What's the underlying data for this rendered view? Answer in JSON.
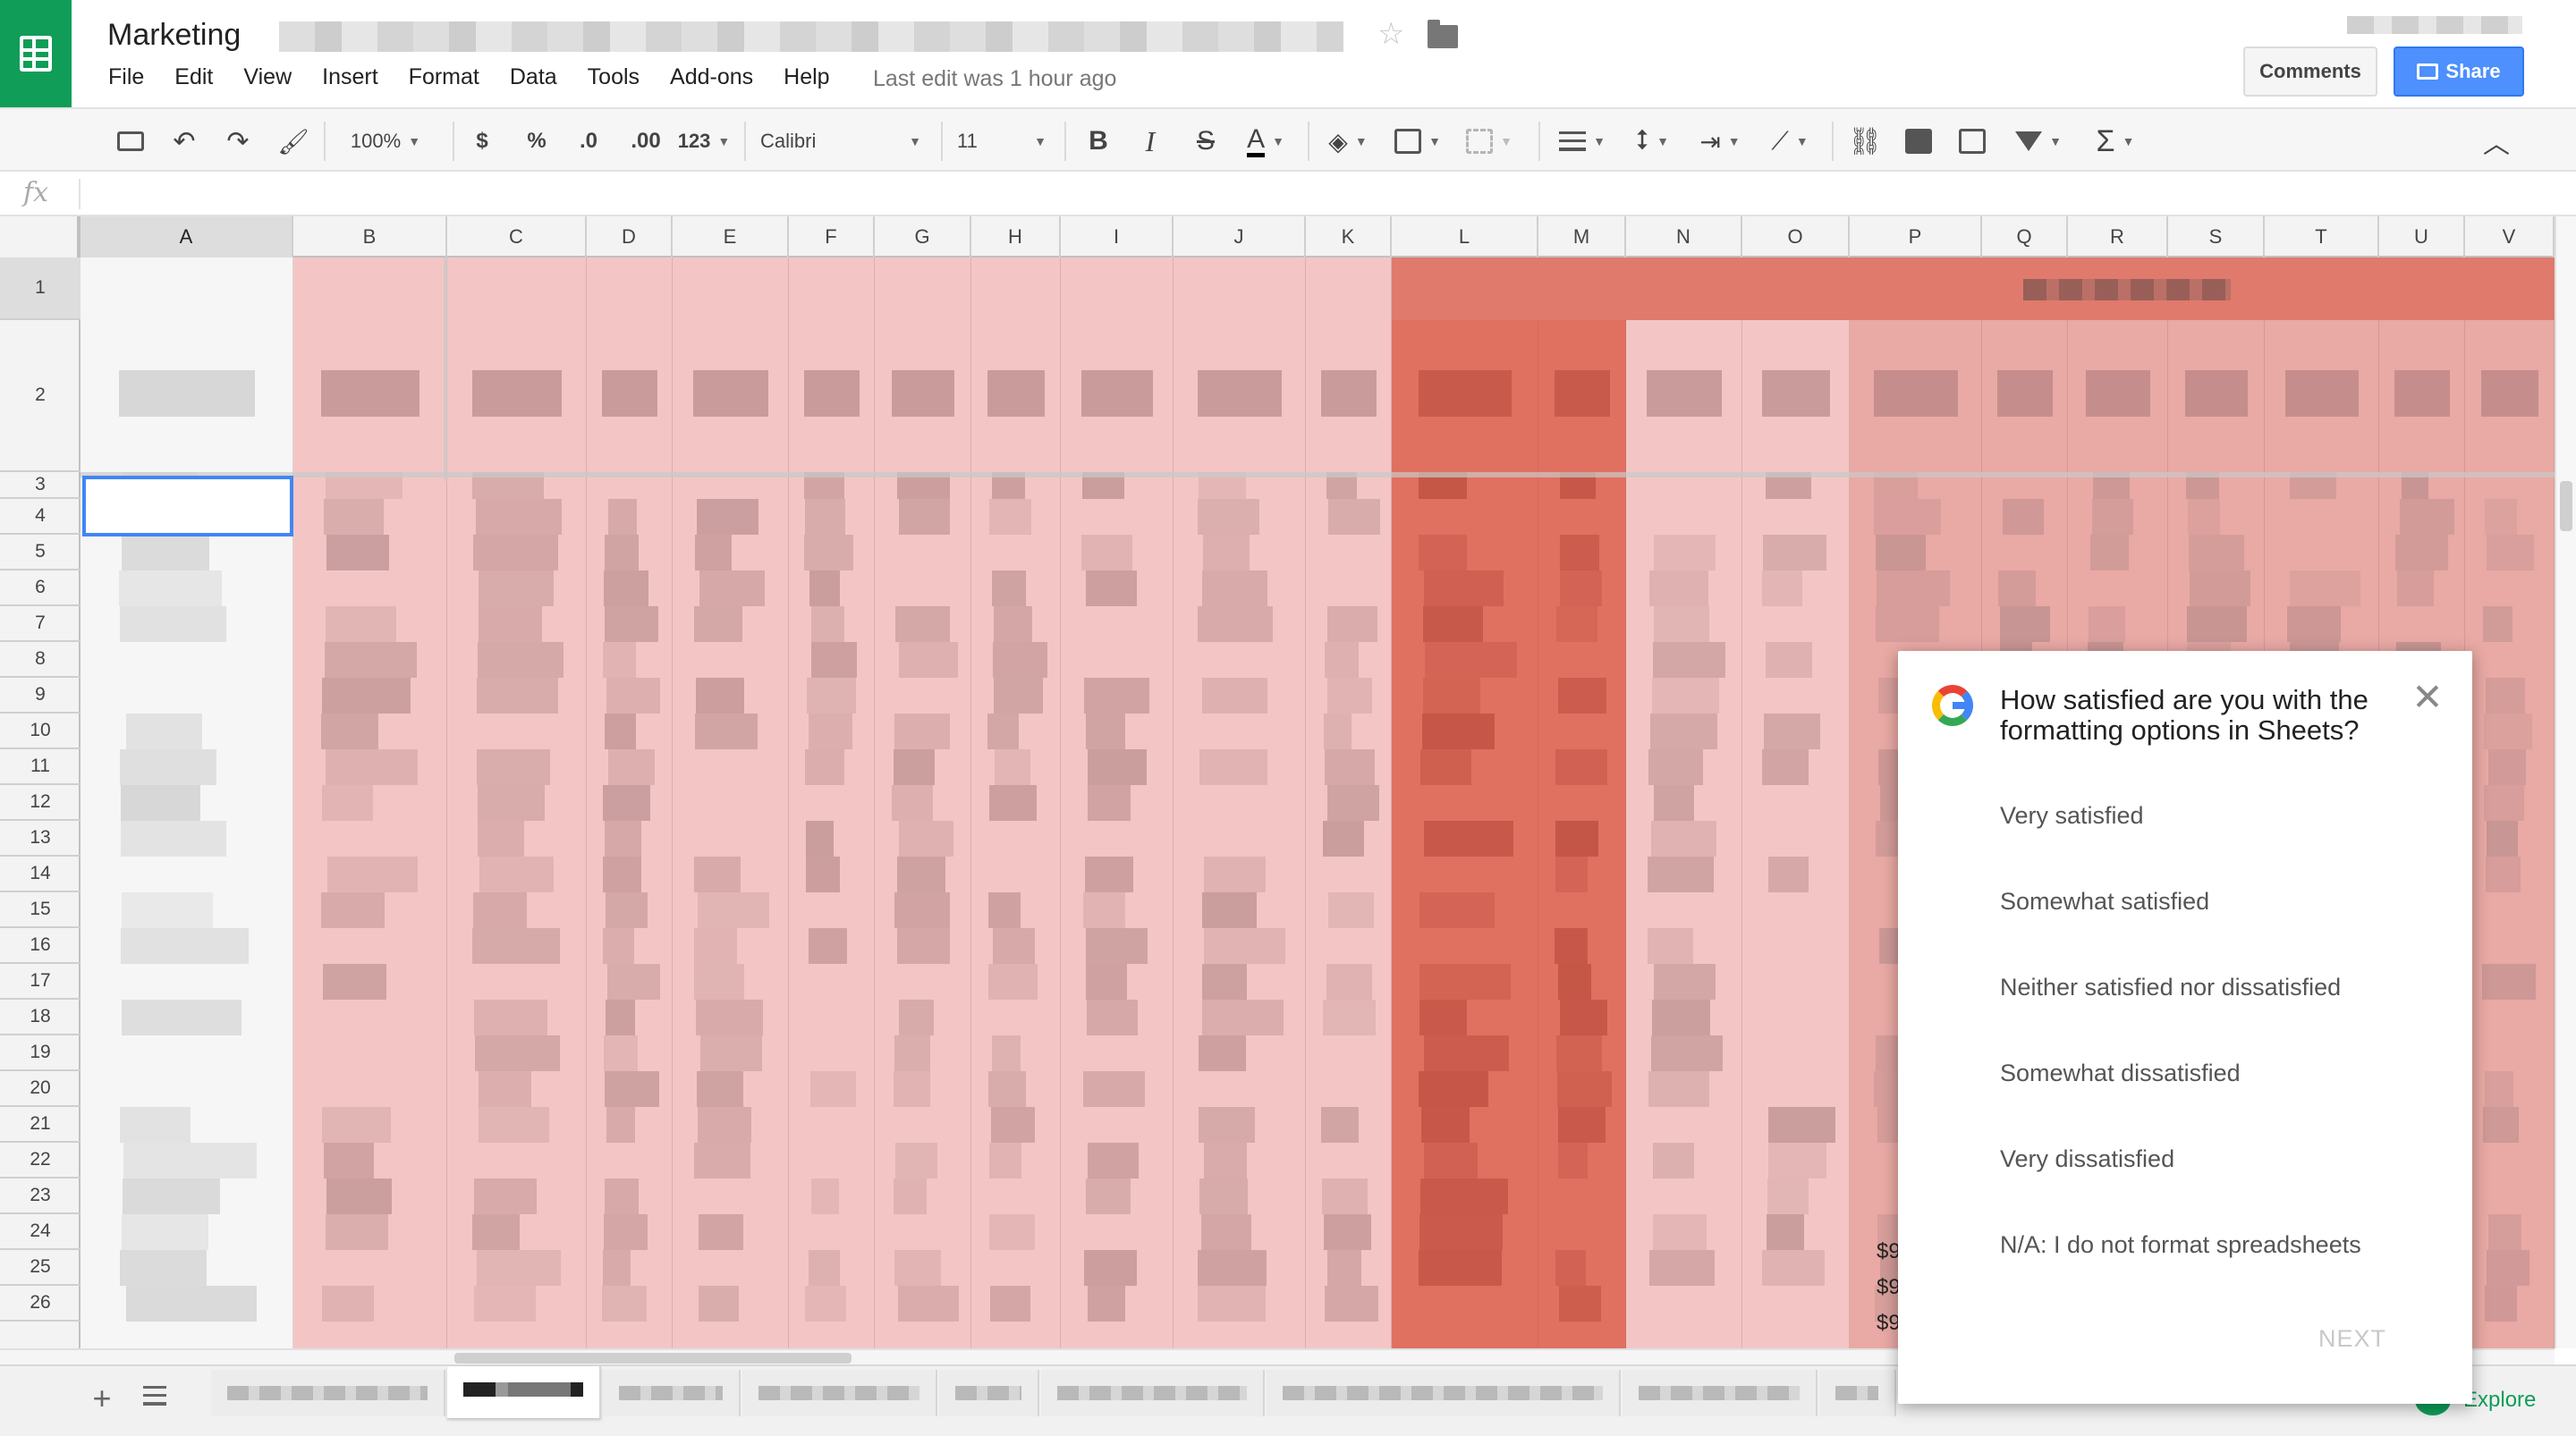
{
  "app": {
    "title": "Marketing",
    "last_edit": "Last edit was 1 hour ago",
    "menu": [
      "File",
      "Edit",
      "View",
      "Insert",
      "Format",
      "Data",
      "Tools",
      "Add-ons",
      "Help"
    ],
    "comments_label": "Comments",
    "share_label": "Share"
  },
  "toolbar": {
    "zoom": "100%",
    "currency": "$",
    "percent": "%",
    "decrease_decimals": ".0",
    "increase_decimals": ".00",
    "number_format": "123",
    "font": "Calibri",
    "font_size": "11",
    "bold": "B",
    "italic": "I",
    "strikethrough": "S",
    "text_color": "A",
    "icons": [
      "print-icon",
      "undo-icon",
      "redo-icon",
      "paint-format-icon",
      "bold-icon",
      "italic-icon",
      "strikethrough-icon",
      "text-color-icon",
      "fill-color-icon",
      "borders-icon",
      "merge-cells-icon",
      "align-left-icon",
      "vertical-align-icon",
      "text-wrap-icon",
      "text-rotation-icon",
      "link-icon",
      "insert-comment-icon",
      "insert-chart-icon",
      "filter-icon",
      "functions-icon",
      "collapse-icon"
    ]
  },
  "formula_bar": {
    "label": "fx"
  },
  "grid": {
    "columns": [
      "A",
      "B",
      "C",
      "D",
      "E",
      "F",
      "G",
      "H",
      "I",
      "J",
      "K",
      "L",
      "M",
      "N",
      "O",
      "P",
      "Q",
      "R",
      "S",
      "T",
      "U",
      "V"
    ],
    "rows": [
      "1",
      "2",
      "3",
      "4",
      "5",
      "6",
      "7",
      "8",
      "9",
      "10",
      "11",
      "12",
      "13",
      "14",
      "15",
      "16",
      "17",
      "18",
      "19",
      "20",
      "21",
      "22",
      "23",
      "24",
      "25",
      "26"
    ],
    "selected_column": "A",
    "selected_row": "1",
    "visible_values": [
      "$9",
      "$9",
      "$9"
    ],
    "colors": {
      "light_fill": "#f3c6c5",
      "mid_fill": "#e9a9a4",
      "dark_fill": "#e07060",
      "header_bg": "#f3f3f3",
      "selection": "#4285f4"
    }
  },
  "sheet_tabs": {
    "add_label": "+",
    "explore_label": "Explore"
  },
  "survey": {
    "question": "How satisfied are you with the formatting options in Sheets?",
    "options": [
      "Very satisfied",
      "Somewhat satisfied",
      "Neither satisfied nor dissatisfied",
      "Somewhat dissatisfied",
      "Very dissatisfied",
      "N/A: I do not format spreadsheets"
    ],
    "next_label": "NEXT",
    "close_label": "✕"
  }
}
